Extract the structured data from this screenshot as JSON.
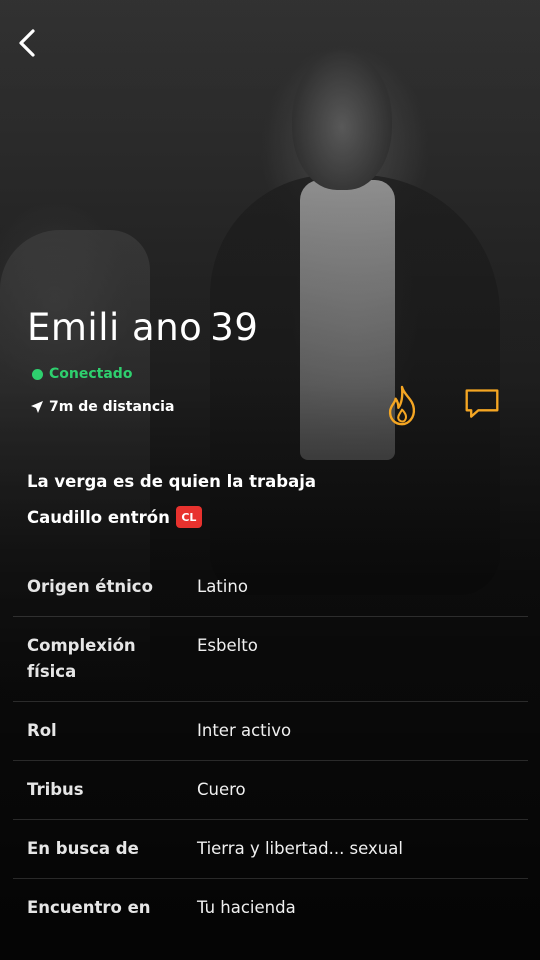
{
  "profile": {
    "display_name": "Emili ano",
    "age": "39",
    "online_status": "Conectado",
    "distance": "7m de distancia",
    "headline": "La verga es de quien la trabaja",
    "about": "Caudillo entrón",
    "about_badge": "CL"
  },
  "details": [
    {
      "label": "Origen étnico",
      "value": "Latino"
    },
    {
      "label": "Complexión física",
      "value": "Esbelto"
    },
    {
      "label": "Rol",
      "value": "Inter activo"
    },
    {
      "label": "Tribus",
      "value": "Cuero"
    },
    {
      "label": "En busca de",
      "value": "Tierra y libertad... sexual"
    },
    {
      "label": "Encuentro en",
      "value": "Tu hacienda"
    }
  ],
  "colors": {
    "online": "#2ed06e",
    "accent": "#f5a623",
    "badge": "#e8322e"
  },
  "icons": [
    "back-arrow-icon",
    "location-arrow-icon",
    "flame-icon",
    "chat-bubble-icon"
  ]
}
